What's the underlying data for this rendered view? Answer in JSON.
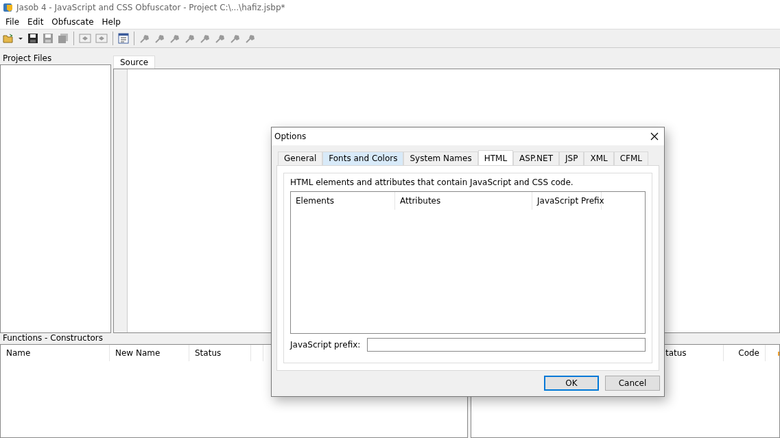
{
  "window": {
    "title": "Jasob 4 - JavaScript and CSS Obfuscator - Project  C:\\...\\hafiz.jsbp*"
  },
  "menu": [
    "File",
    "Edit",
    "Obfuscate",
    "Help"
  ],
  "toolbar": [
    {
      "kind": "open",
      "disabled": false
    },
    {
      "kind": "dropdown",
      "disabled": false
    },
    {
      "kind": "save",
      "disabled": false
    },
    {
      "kind": "save",
      "disabled": true
    },
    {
      "kind": "save-all",
      "disabled": true
    },
    {
      "kind": "separator"
    },
    {
      "kind": "frame",
      "disabled": true
    },
    {
      "kind": "frame",
      "disabled": true
    },
    {
      "kind": "separator"
    },
    {
      "kind": "options",
      "disabled": false
    },
    {
      "kind": "separator"
    },
    {
      "kind": "tool",
      "disabled": true
    },
    {
      "kind": "tool",
      "disabled": true
    },
    {
      "kind": "tool",
      "disabled": true
    },
    {
      "kind": "tool",
      "disabled": true
    },
    {
      "kind": "tool",
      "disabled": true
    },
    {
      "kind": "tool",
      "disabled": true
    },
    {
      "kind": "tool",
      "disabled": true
    },
    {
      "kind": "tool",
      "disabled": true
    }
  ],
  "project_files": {
    "title": "Project Files"
  },
  "editor": {
    "tabs": [
      {
        "label": "Source",
        "selected": true
      }
    ]
  },
  "functions": {
    "title": "Functions - Constructors",
    "columns": [
      "Name",
      "New Name",
      "Status"
    ]
  },
  "right_list": {
    "columns": [
      "tatus",
      "Code"
    ]
  },
  "dialog": {
    "title": "Options",
    "tabs": [
      {
        "label": "General",
        "selected": false,
        "hovered": false
      },
      {
        "label": "Fonts and Colors",
        "selected": false,
        "hovered": true
      },
      {
        "label": "System Names",
        "selected": false,
        "hovered": false
      },
      {
        "label": "HTML",
        "selected": true,
        "hovered": false
      },
      {
        "label": "ASP.NET",
        "selected": false,
        "hovered": false
      },
      {
        "label": "JSP",
        "selected": false,
        "hovered": false
      },
      {
        "label": "XML",
        "selected": false,
        "hovered": false
      },
      {
        "label": "CFML",
        "selected": false,
        "hovered": false
      }
    ],
    "description": "HTML elements and attributes that contain JavaScript and CSS code.",
    "columns": [
      "Elements",
      "Attributes",
      "JavaScript Prefix"
    ],
    "prefix_label": "JavaScript prefix:",
    "buttons": [
      {
        "label": "OK",
        "default": true
      },
      {
        "label": "Cancel",
        "default": false
      }
    ]
  }
}
